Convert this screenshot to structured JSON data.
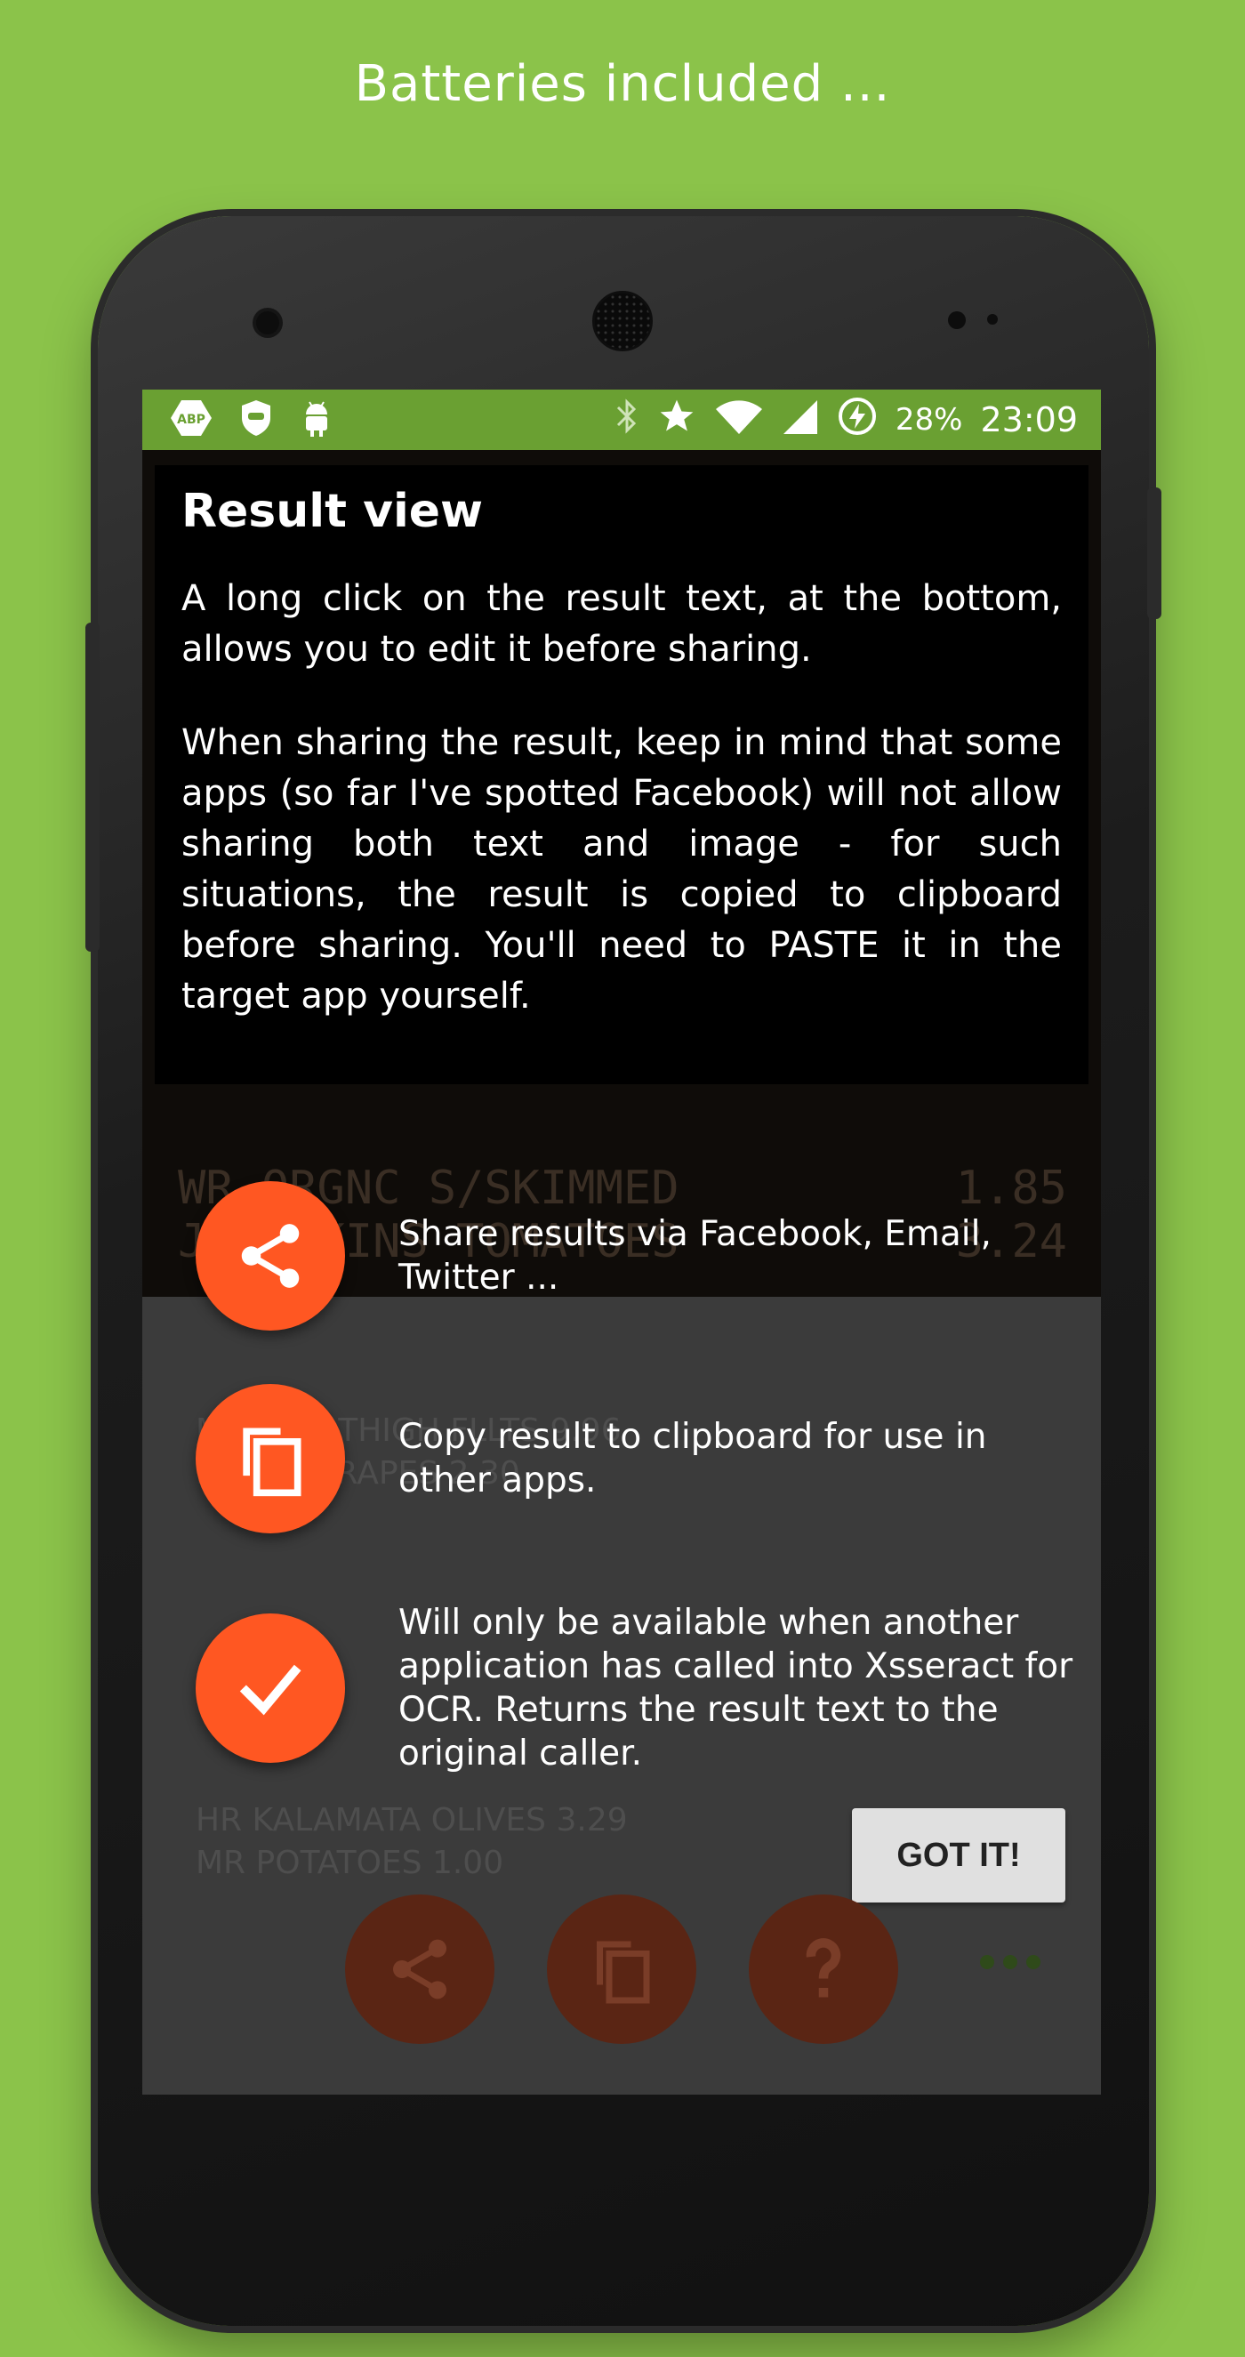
{
  "headline": "Batteries included ...",
  "status_bar": {
    "left_icons": [
      "abp-icon",
      "shield-icon",
      "android-icon"
    ],
    "right_icons": [
      "bluetooth-icon",
      "star-icon",
      "wifi-icon",
      "signal-icon",
      "battery-charging-icon"
    ],
    "battery": "28%",
    "time": "23:09"
  },
  "background_receipt": {
    "top_lines": [
      {
        "name": "WR ORGNC S/SKIMMED",
        "price": "1.85"
      },
      {
        "name": "J/WATKINS TOMATOES",
        "price": "3.24"
      }
    ],
    "result_lines": [
      "MR ORG THIGH FLLTS 9.96",
      "BLACK GRAPES 2.30",
      "HR KALAMATA OLIVES 3.29",
      "MR POTATOES 1.00"
    ]
  },
  "result_card": {
    "title": "Result view",
    "paragraph1": "A long click on the result text, at the bottom, allows you to edit it before sharing.",
    "paragraph2": "When sharing the result, keep in mind that some apps (so far I've spotted Facebook) will not allow sharing both text and image - for such situations, the result is copied to clipboard before sharing. You'll need to PASTE it in the target app yourself."
  },
  "tips": [
    {
      "icon": "share-icon",
      "text": "Share results via Facebook, Email, Twitter ..."
    },
    {
      "icon": "copy-icon",
      "text": "Copy result to clipboard for use in other apps."
    },
    {
      "icon": "check-icon",
      "text": "Will only be available when another application has called into Xsseract for OCR. Returns the result text to the original caller."
    }
  ],
  "got_it_label": "GOT IT!",
  "bottom_actions": [
    "share-icon",
    "copy-icon",
    "help-icon",
    "more-icon"
  ],
  "colors": {
    "background": "#8bc34a",
    "status_bar": "#6aa032",
    "accent": "#ff5722"
  }
}
